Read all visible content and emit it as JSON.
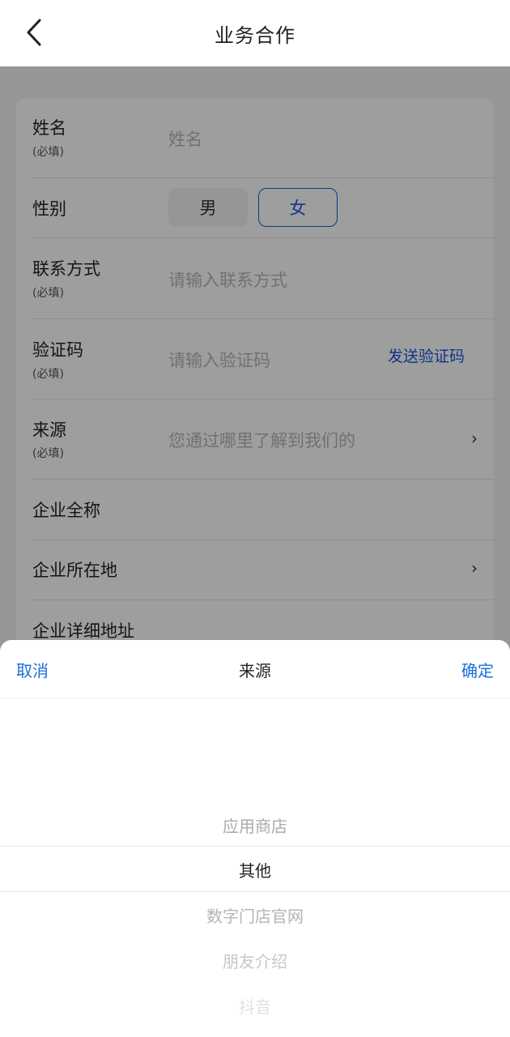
{
  "header": {
    "title": "业务合作"
  },
  "form": {
    "name": {
      "label": "姓名",
      "required": "(必填)",
      "placeholder": "姓名"
    },
    "gender": {
      "label": "性别",
      "male": "男",
      "female": "女"
    },
    "contact": {
      "label": "联系方式",
      "required": "(必填)",
      "placeholder": "请输入联系方式"
    },
    "code": {
      "label": "验证码",
      "required": "(必填)",
      "placeholder": "请输入验证码",
      "send": "发送验证码"
    },
    "source": {
      "label": "来源",
      "required": "(必填)",
      "placeholder": "您通过哪里了解到我们的",
      "chevron": "›"
    },
    "company_name": {
      "label": "企业全称"
    },
    "company_location": {
      "label": "企业所在地",
      "chevron": "›"
    },
    "company_address": {
      "label": "企业详细地址"
    }
  },
  "picker": {
    "cancel": "取消",
    "title": "来源",
    "confirm": "确定",
    "options": [
      "应用商店",
      "其他",
      "数字门店官网",
      "朋友介绍",
      "抖音"
    ],
    "selected": "其他"
  },
  "colors": {
    "accent": "#1a56d8",
    "sheet_accent": "#1a6fd8"
  }
}
